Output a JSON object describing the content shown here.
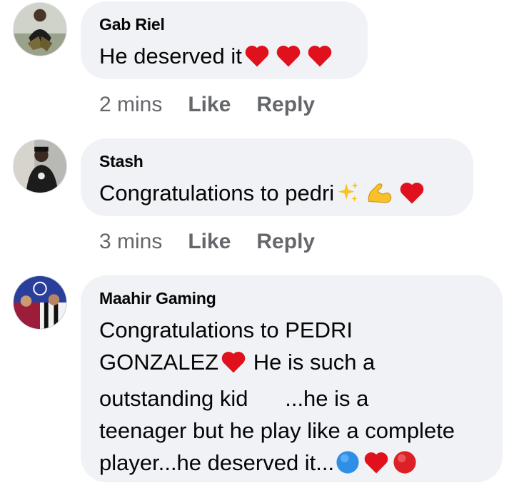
{
  "comments": [
    {
      "author": "Gab Riel",
      "lines": [
        "He deserved it"
      ],
      "time": "2 mins",
      "like_label": "Like",
      "reply_label": "Reply"
    },
    {
      "author": "Stash",
      "lines": [
        "Congratulations to pedri"
      ],
      "time": "3 mins",
      "like_label": "Like",
      "reply_label": "Reply"
    },
    {
      "author": "Maahir Gaming",
      "lines": [
        "Congratulations to PEDRI",
        "GONZALEZ",
        " He is such a",
        "outstanding kid      ...he is a",
        "teenager but he play like a complete",
        "player...he deserved it..."
      ]
    }
  ],
  "colors": {
    "bubble": "#f0f2f5",
    "text": "#050505",
    "meta": "#65676b",
    "heart": "#e0111c",
    "blue_circle": "#2f8fe6",
    "red_circle": "#dd1f26"
  },
  "icons": [
    "heart-icon",
    "sparkles-icon",
    "flexed-biceps-icon",
    "blue-circle-icon",
    "red-circle-icon"
  ]
}
